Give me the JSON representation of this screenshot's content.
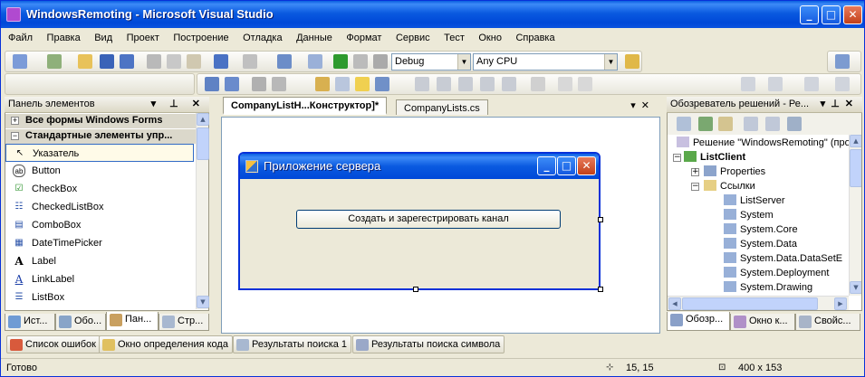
{
  "window": {
    "title": "WindowsRemoting - Microsoft Visual Studio",
    "controls": [
      "_",
      "□",
      "✕"
    ]
  },
  "menu": [
    "Файл",
    "Правка",
    "Вид",
    "Проект",
    "Построение",
    "Отладка",
    "Данные",
    "Формат",
    "Сервис",
    "Тест",
    "Окно",
    "Справка"
  ],
  "toolbar": {
    "config": "Debug",
    "platform": "Any CPU"
  },
  "toolbox": {
    "title": "Панель элементов",
    "groups": [
      {
        "label": "Все формы Windows Forms",
        "sign": "+"
      },
      {
        "label": "Стандартные элементы упр...",
        "sign": "−"
      }
    ],
    "items": [
      {
        "label": "Указатель",
        "glyph": "↖"
      },
      {
        "label": "Button",
        "glyph": "ab"
      },
      {
        "label": "CheckBox",
        "glyph": "☑"
      },
      {
        "label": "CheckedListBox",
        "glyph": "☷"
      },
      {
        "label": "ComboBox",
        "glyph": "▤"
      },
      {
        "label": "DateTimePicker",
        "glyph": "▦"
      },
      {
        "label": "Label",
        "glyph": "A"
      },
      {
        "label": "LinkLabel",
        "glyph": "A"
      },
      {
        "label": "ListBox",
        "glyph": "☰"
      }
    ],
    "tabs": [
      "Ист...",
      "Обо...",
      "Пан...",
      "Стр..."
    ]
  },
  "editor": {
    "tabs": [
      "CompanyListH...Конструктор]*",
      "CompanyLists.cs"
    ],
    "form": {
      "title": "Приложение сервера",
      "button": "Создать и зарегестрировать канал"
    }
  },
  "solution": {
    "title": "Обозреватель решений - Ре...",
    "nodes": [
      {
        "label": "Решение \"WindowsRemoting\" (про",
        "level": 0,
        "bold": false
      },
      {
        "label": "ListClient",
        "level": 0,
        "bold": true
      },
      {
        "label": "Properties",
        "level": 1,
        "bold": false
      },
      {
        "label": "Ссылки",
        "level": 1,
        "bold": false
      },
      {
        "label": "ListServer",
        "level": 2,
        "bold": false
      },
      {
        "label": "System",
        "level": 2,
        "bold": false
      },
      {
        "label": "System.Core",
        "level": 2,
        "bold": false
      },
      {
        "label": "System.Data",
        "level": 2,
        "bold": false
      },
      {
        "label": "System.Data.DataSetE",
        "level": 2,
        "bold": false
      },
      {
        "label": "System.Deployment",
        "level": 2,
        "bold": false
      },
      {
        "label": "System.Drawing",
        "level": 2,
        "bold": false
      }
    ],
    "tabs": [
      "Обозр...",
      "Окно к...",
      "Свойс..."
    ]
  },
  "bottom_tabs": [
    "Список ошибок",
    "Окно определения кода",
    "Результаты поиска 1",
    "Результаты поиска символа"
  ],
  "status": {
    "text": "Готово",
    "position": "15, 15",
    "size": "400 x 153"
  }
}
